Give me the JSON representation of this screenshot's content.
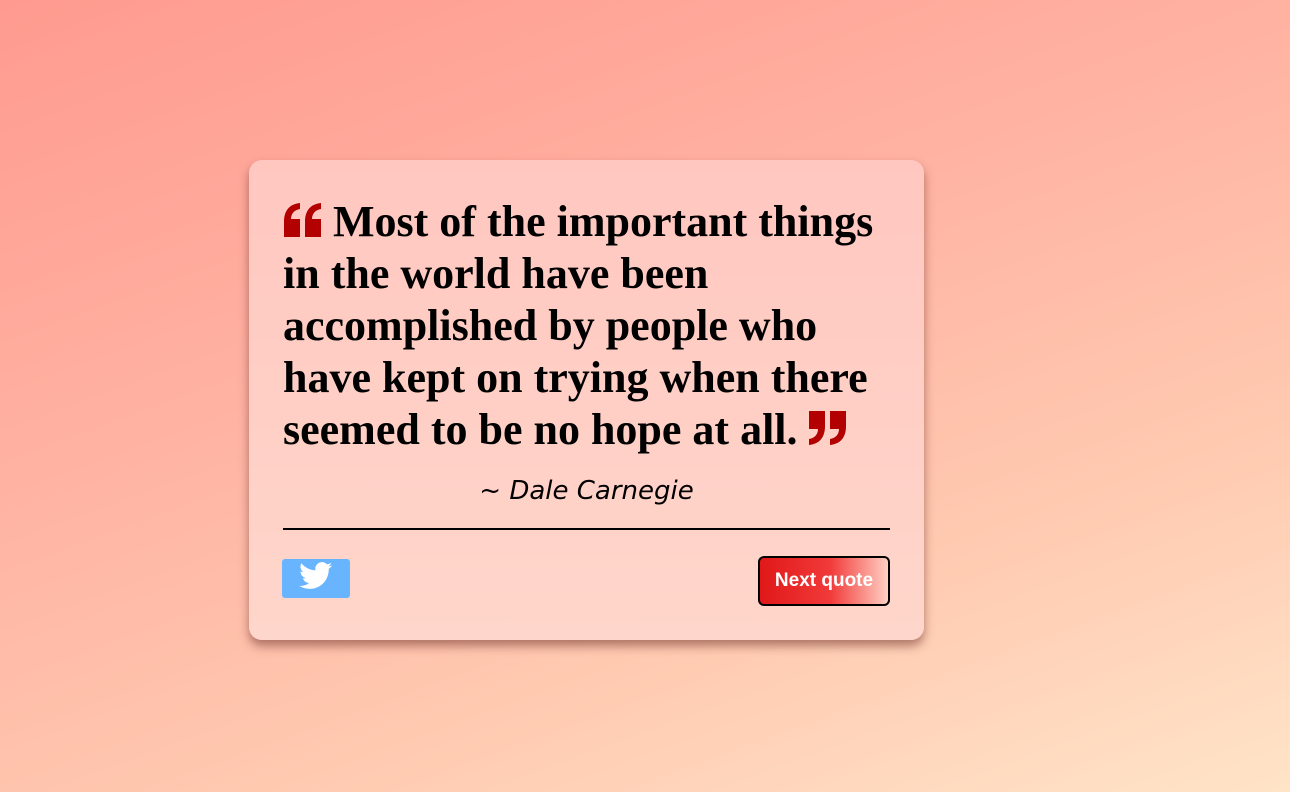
{
  "quote": {
    "text": "Most of the important things in the world have been accomplished by people who have kept on trying when there seemed to be no hope at all.",
    "author": "~ Dale Carnegie",
    "open_icon": "quote-open-icon",
    "close_icon": "quote-close-icon",
    "accent_color": "#b30000"
  },
  "actions": {
    "tweet_icon": "twitter-icon",
    "tweet_color": "#69b4ff",
    "next_label": "Next quote",
    "next_color": "#e01818"
  }
}
